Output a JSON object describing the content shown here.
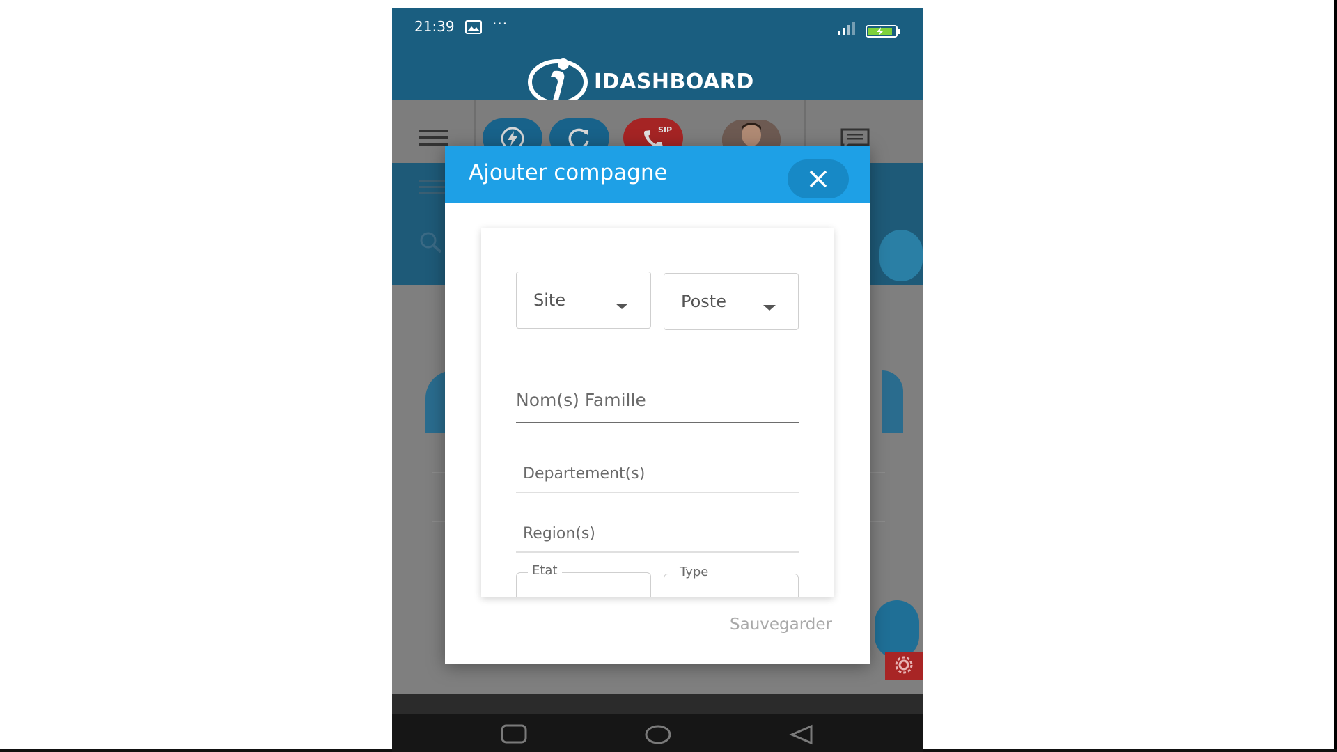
{
  "status_bar": {
    "time": "21:39",
    "more": "···",
    "icons": [
      "image-icon",
      "signal-icon",
      "battery-charging-icon"
    ]
  },
  "brand": {
    "name": "IDASHBOARD",
    "logo_icon": "idashboard-logo"
  },
  "toolbar": {
    "buttons": [
      "menu-icon",
      "flash-icon",
      "refresh-icon",
      "sip-phone-icon",
      "avatar",
      "chat-icon"
    ],
    "sip_label": "SIP"
  },
  "colors": {
    "header_bg": "#1a5e80",
    "modal_header": "#1ea0e6",
    "sip_button": "#d62e2e",
    "action_button": "#1e7db3"
  },
  "modal": {
    "title": "Ajouter compagne",
    "close_icon": "close-icon",
    "selects": {
      "site": "Site",
      "poste": "Poste"
    },
    "fields": {
      "famille_placeholder": "Nom(s) Famille",
      "departement_placeholder": "Departement(s)",
      "region_placeholder": "Region(s)"
    },
    "outlined": {
      "etat_label": "Etat",
      "type_label": "Type"
    },
    "save_label": "Sauvegarder"
  },
  "nav_bar": {
    "icons": [
      "recents-icon",
      "home-icon",
      "back-icon"
    ]
  }
}
